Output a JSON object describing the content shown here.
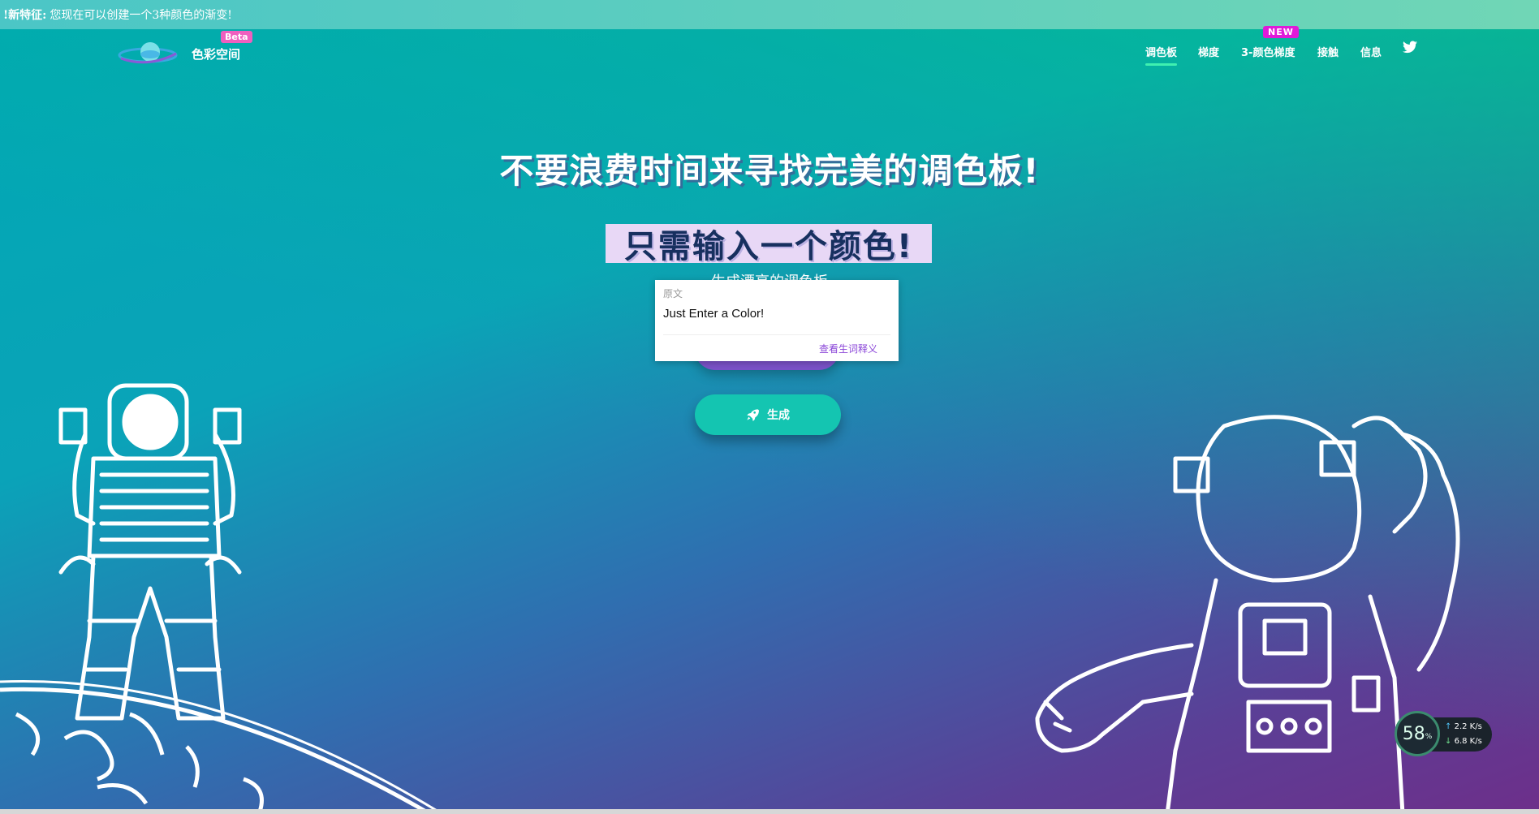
{
  "announcement": {
    "prefix": "!新特征:",
    "text": "您现在可以创建一个3种颜色的渐变!"
  },
  "nav": {
    "brand": "色彩空间",
    "beta": "Beta",
    "items": [
      {
        "label": "调色板",
        "active": true
      },
      {
        "label": "梯度"
      },
      {
        "label": "3-颜色梯度",
        "badge": "NEW"
      },
      {
        "label": "接触"
      },
      {
        "label": "信息"
      }
    ],
    "twitter_icon": "twitter-icon"
  },
  "hero": {
    "title": "不要浪费时间来寻找完美的调色板!",
    "subtitle": "只需输入一个颜色!",
    "description": "生成漂亮的调色板",
    "generate_label": "生成"
  },
  "translation_popup": {
    "label": "原文",
    "text": "Just Enter a Color!",
    "link": "查看生词释义"
  },
  "speed_widget": {
    "percent": "58",
    "unit": "%",
    "up": "2.2",
    "down": "6.8",
    "rate_unit": "K/s"
  },
  "colors": {
    "accent": "#14c5b1",
    "purple": "#7a52c7",
    "badge_pink": "#e01ad9",
    "beta_pink": "#ef5fbf"
  }
}
